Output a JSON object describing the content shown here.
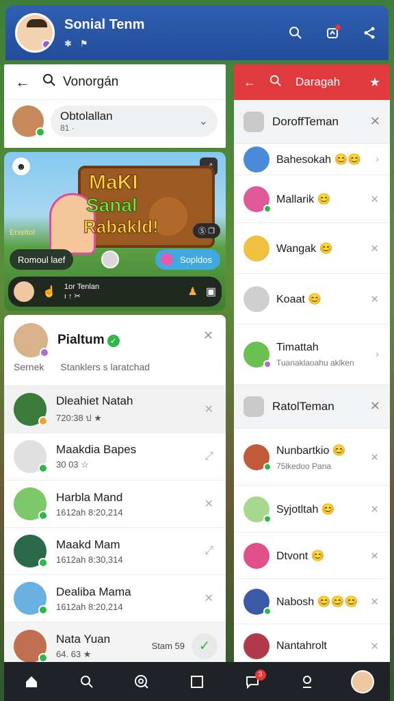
{
  "header": {
    "title": "Sonial Tenm",
    "mini_icons": [
      "✱",
      "⚑"
    ],
    "actions": [
      "search-icon",
      "notification-icon",
      "share-icon"
    ]
  },
  "left_panel": {
    "search_text": "Vonorgán",
    "chip": {
      "title": "Obtolallan",
      "subtitle": "81 ·"
    },
    "banner": {
      "word1": "MaKI",
      "word2": "Sanal",
      "word3": "Rabakld!",
      "left_pill": "Romoul laef",
      "right_pill": "Sopldos",
      "mini_bl": "Erxeltol",
      "mini_br": "Ⓢ ❐",
      "bar_text_1": "1or Tenlan",
      "bar_text_2": "ı ↑ ✂"
    },
    "list_head": {
      "name": "Pialtum",
      "col1": "Sernek",
      "col2": "Stanklers s laratchad"
    },
    "items": [
      {
        "name": "Dleahiet Natah",
        "meta": "720:38  ป  ★"
      },
      {
        "name": "Maakdia Bapes",
        "meta": "30  03  ☆"
      },
      {
        "name": "Harbla Mand",
        "meta": "1612ah  8:20,214"
      },
      {
        "name": "Maakd Mam",
        "meta": "1612ah  8:30,314"
      },
      {
        "name": "Dealiba Mama",
        "meta": "1612ah  8:20,214"
      },
      {
        "name": "Nata Yuan",
        "meta": "64.  63  ★",
        "pill": "Stam 59"
      }
    ]
  },
  "right_panel": {
    "search_text": "Daragah",
    "section1": "DoroffTeman",
    "items1": [
      {
        "name": "Bahesokah 😊😊"
      },
      {
        "name": "Mallarik 😊"
      },
      {
        "name": "Wangak 😊"
      },
      {
        "name": "Koaat 😊"
      },
      {
        "name": "Timattah",
        "sub": "Tuanaklaoahu aklken"
      }
    ],
    "section2": "RatolTeman",
    "items2": [
      {
        "name": "Nunbartkio 😊",
        "sub": "75lkedoo Pana"
      },
      {
        "name": "Syjotltah 😊"
      },
      {
        "name": "Dtvont 😊"
      },
      {
        "name": "Nabosh 😊😊😊"
      },
      {
        "name": "Nantahrolt"
      }
    ]
  },
  "bottom_nav": {
    "items": [
      "home-icon",
      "search-icon",
      "explore-icon",
      "square-icon",
      "chat-icon",
      "pin-icon",
      "profile-avatar"
    ],
    "chat_badge": "3"
  },
  "colors": {
    "header_blue": "#2f5fb0",
    "accent_red": "#df3a3e",
    "online_green": "#2eb84a",
    "nav_dark": "#1f2328"
  }
}
